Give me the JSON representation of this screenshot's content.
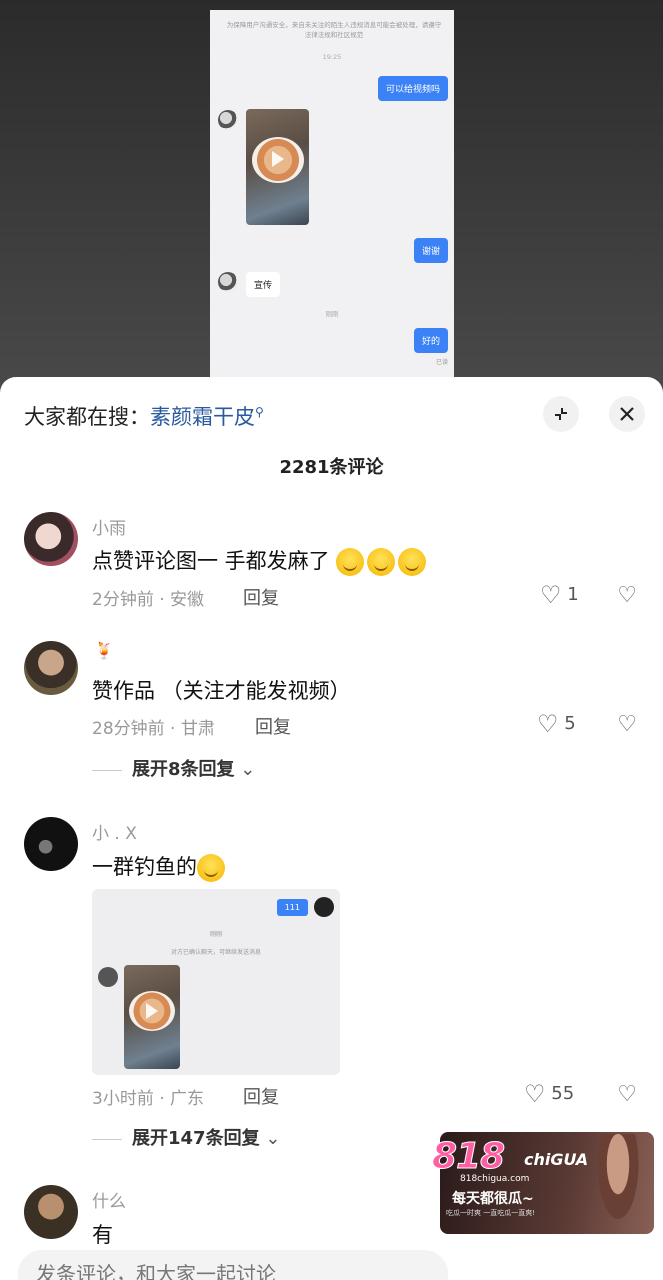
{
  "chat_preview": {
    "notice": "为保障用户沟通安全，来自未关注的陌生人违规消息可能会被处理，请遵守法律法规和社区规范",
    "time": "19:25",
    "msg_request": "可以给视频吗",
    "msg_thanks": "谢谢",
    "msg_promo": "宣传",
    "time2": "刚刚",
    "msg_ok": "好的",
    "read_status": "已读"
  },
  "sheet": {
    "search_prefix": "大家都在搜：",
    "search_keyword": "素颜霜干皮",
    "comment_count": "2281条评论"
  },
  "comments": [
    {
      "name": "小雨",
      "text": "点赞评论图一 手都发麻了",
      "meta": "2分钟前 · 安徽",
      "reply": "回复",
      "likes": "1"
    },
    {
      "name": "🍹",
      "text": "赞作品 （关注才能发视频）",
      "meta": "28分钟前 · 甘肃",
      "reply": "回复",
      "likes": "5",
      "expand": "展开8条回复"
    },
    {
      "name": "小 . X",
      "text": "一群钓鱼的",
      "meta": "3小时前 · 广东",
      "reply": "回复",
      "likes": "55",
      "expand": "展开147条回复",
      "image": {
        "bubble": "111",
        "time": "刚刚",
        "notice": "对方已确认聊天，可继续发送消息"
      }
    },
    {
      "name": "什么",
      "text": "有"
    }
  ],
  "input": {
    "placeholder": "发条评论，和大家一起讨论"
  },
  "ad": {
    "logo_num": "818",
    "logo_text": "chiGUA",
    "url": "818chigua.com",
    "slogan": "每天都很瓜~",
    "sub": "吃瓜一时爽 一直吃瓜一直爽!"
  },
  "icons": {
    "search_hint": "search-icon",
    "collapse": "shrink-icon",
    "close": "close-icon",
    "like": "heart-icon",
    "dislike": "broken-heart-icon"
  }
}
